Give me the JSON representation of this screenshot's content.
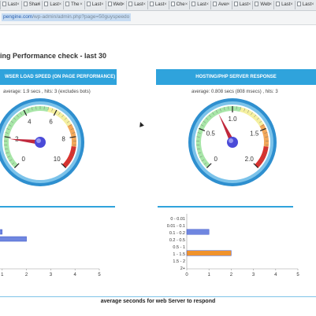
{
  "browser": {
    "tabs": [
      {
        "label": "Last"
      },
      {
        "label": "Shari"
      },
      {
        "label": "Last"
      },
      {
        "label": "The"
      },
      {
        "label": "Last"
      },
      {
        "label": "Web"
      },
      {
        "label": "Last"
      },
      {
        "label": "Last"
      },
      {
        "label": "Che"
      },
      {
        "label": "Last"
      },
      {
        "label": "Aver"
      },
      {
        "label": "Last"
      },
      {
        "label": "Web"
      },
      {
        "label": "Last"
      },
      {
        "label": "Last"
      }
    ],
    "url_host": "pengine.com",
    "url_path": "/wp-admin/admin.php?page=50guyspeedo"
  },
  "page": {
    "title": "ing Performance check - last 30",
    "left_panel": {
      "header": "WSER LOAD SPEED (ON PAGE PERFORMANCE)",
      "subtitle": "average: 1.9 secs , hits: 3 (excludes bots)"
    },
    "right_panel": {
      "header": "HOSTING/PHP SERVER RESPONSE",
      "subtitle": "average: 0.808 secs (808 msecs) , hits: 3"
    },
    "footer_caption": "average seconds for web Server to respond"
  },
  "colors": {
    "accent": "#2fa3dc",
    "bar_blue": "#6f86e0",
    "bar_orange": "#f0932c",
    "needle": "#c0283c"
  },
  "chart_data": [
    {
      "type": "gauge",
      "ticks": [
        "0",
        "2",
        "4",
        "6",
        "8",
        "10"
      ],
      "range": [
        0,
        10
      ],
      "value": 1.9
    },
    {
      "type": "gauge",
      "ticks": [
        "0",
        "0.5",
        "1.0",
        "1.5",
        "2.0"
      ],
      "range": [
        0,
        2
      ],
      "value": 0.808
    },
    {
      "type": "bar",
      "orientation": "horizontal",
      "categories": [
        "",
        ""
      ],
      "series": [
        {
          "values": [
            1,
            2
          ]
        }
      ],
      "xticks": [
        "1",
        "2",
        "3",
        "4",
        "5"
      ],
      "xlim": [
        0,
        5
      ]
    },
    {
      "type": "bar",
      "orientation": "horizontal",
      "categories": [
        "0 - 0.01",
        "0.01 - 0.1",
        "0.1 - 0.2",
        "0.2 - 0.5",
        "0.5 - 1",
        "1 - 1.5",
        "1.5 - 2",
        "2+"
      ],
      "series": [
        {
          "values": [
            0,
            0,
            1,
            0,
            0,
            2,
            0,
            0
          ]
        }
      ],
      "xticks": [
        "0",
        "1",
        "2",
        "3",
        "4",
        "5"
      ],
      "xlim": [
        0,
        5
      ]
    }
  ]
}
